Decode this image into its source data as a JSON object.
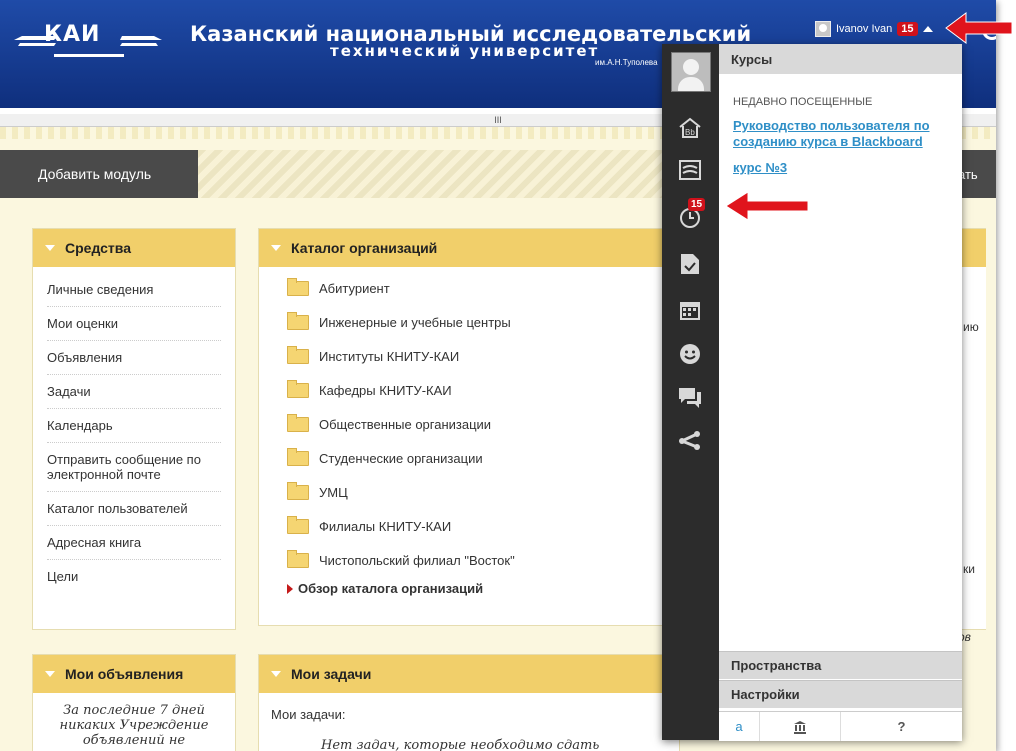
{
  "header": {
    "logo_text": "КАИ",
    "university_line1": "Казанский национальный исследовательский",
    "university_line2": "технический университет",
    "university_line3": "им.А.Н.Туполева",
    "user_name": "Ivanov Ivan",
    "notification_count": "15"
  },
  "scrollbar_marker": "III",
  "toolbar": {
    "add_module_label": "Добавить модуль",
    "edit_partial": "ать"
  },
  "tools_module": {
    "title": "Средства",
    "items": [
      "Личные сведения",
      "Мои оценки",
      "Объявления",
      "Задачи",
      "Календарь",
      "Отправить сообщение по электронной почте",
      "Каталог пользователей",
      "Адресная книга",
      "Цели"
    ]
  },
  "catalog_module": {
    "title": "Каталог организаций",
    "items": [
      "Абитуриент",
      "Инженерные и учебные центры",
      "Институты КНИТУ-КАИ",
      "Кафедры КНИТУ-КАИ",
      "Общественные организации",
      "Студенческие организации",
      "УМЦ",
      "Филиалы КНИТУ-КАИ",
      "Чистопольский филиал \"Восток\""
    ],
    "browse_link": "Обзор каталога организаций"
  },
  "announcements_module": {
    "title": "Мои объявления",
    "text": "За последние 7 дней никаких Учреждение объявлений не"
  },
  "tasks_module": {
    "title": "Мои задачи",
    "label": "Мои задачи:",
    "empty_text": "Нет задач, которые необходимо сдать"
  },
  "right_fragments": {
    "frag1": "ию",
    "frag2": "ки",
    "frag3": "ов"
  },
  "menu": {
    "courses_header": "Курсы",
    "recent_label": "НЕДАВНО ПОСЕЩЕННЫЕ",
    "recent_courses": [
      "Руководство пользователя по созданию курса в Blackboard",
      "курс №3"
    ],
    "rail_badge": "15",
    "spaces_label": "Пространства",
    "settings_label": "Настройки",
    "footer_left": "а",
    "footer_help": "?"
  },
  "colors": {
    "header_blue": "#1f4ba8",
    "module_header": "#f1cf6a",
    "badge_red": "#d0111b",
    "link_blue": "#2f8fc7",
    "arrow_red": "#e0141c"
  }
}
